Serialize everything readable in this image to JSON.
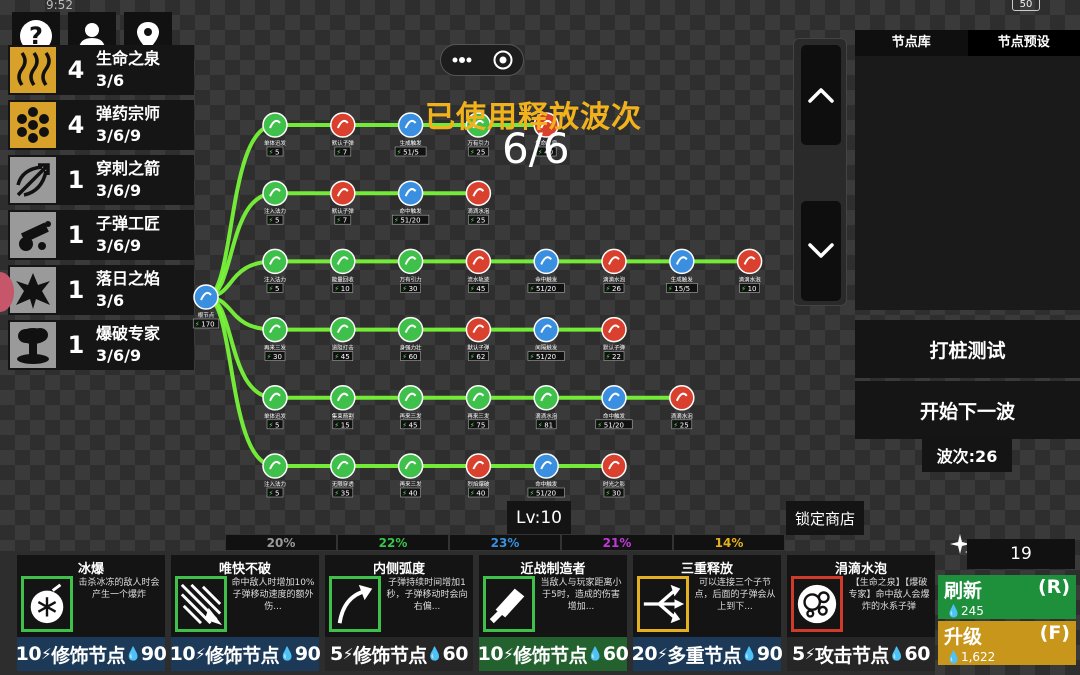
{
  "status": {
    "time": "9:52",
    "battery": "50"
  },
  "top_buttons": [
    {
      "icon": "help-icon"
    },
    {
      "icon": "user-icon"
    },
    {
      "icon": "location-icon"
    }
  ],
  "synergies": [
    {
      "icon": "steam-icon",
      "count": "4",
      "name": "生命之泉",
      "tiers": "3/6",
      "color": "gold"
    },
    {
      "icon": "ammo-icon",
      "count": "4",
      "name": "弹药宗师",
      "tiers": "3/6/9",
      "color": "gold"
    },
    {
      "icon": "arrow-icon",
      "count": "1",
      "name": "穿刺之箭",
      "tiers": "3/6/9",
      "color": "gray"
    },
    {
      "icon": "cannon-icon",
      "count": "1",
      "name": "子弹工匠",
      "tiers": "3/6/9",
      "color": "gray"
    },
    {
      "icon": "flame-icon",
      "count": "1",
      "name": "落日之焰",
      "tiers": "3/6",
      "color": "gray"
    },
    {
      "icon": "explosion-icon",
      "count": "1",
      "name": "爆破专家",
      "tiers": "3/6/9",
      "color": "gray"
    }
  ],
  "overlay": {
    "wave_used_title": "已使用释放波次",
    "wave_used_count": "6/6"
  },
  "graph": {
    "root": {
      "label": "根节点",
      "value": "170"
    },
    "rows": [
      {
        "nodes": [
          {
            "kind": "green",
            "label": "单体迅发",
            "value": "5"
          },
          {
            "kind": "red",
            "label": "默认子弹",
            "value": "7"
          },
          {
            "kind": "blue",
            "label": "生成触发",
            "value": "51/5"
          },
          {
            "kind": "green",
            "label": "万有引力",
            "value": "25"
          },
          {
            "kind": "red",
            "label": "生命之泉",
            "value": "40"
          }
        ]
      },
      {
        "nodes": [
          {
            "kind": "green",
            "label": "注入法力",
            "value": "5"
          },
          {
            "kind": "red",
            "label": "默认子弹",
            "value": "7"
          },
          {
            "kind": "blue",
            "label": "命中触发",
            "value": "51/20"
          },
          {
            "kind": "red",
            "label": "滴滴水泡",
            "value": "25"
          }
        ]
      },
      {
        "nodes": [
          {
            "kind": "green",
            "label": "注入法力",
            "value": "5"
          },
          {
            "kind": "green",
            "label": "能量回收",
            "value": "10"
          },
          {
            "kind": "green",
            "label": "万有引力",
            "value": "30"
          },
          {
            "kind": "red",
            "label": "流水轨迹",
            "value": "45"
          },
          {
            "kind": "blue",
            "label": "命中触发",
            "value": "51/20"
          },
          {
            "kind": "red",
            "label": "滴滴水泡",
            "value": "26"
          },
          {
            "kind": "blue",
            "label": "生成触发",
            "value": "15/5"
          },
          {
            "kind": "red",
            "label": "滴滴水泡",
            "value": "10"
          }
        ]
      },
      {
        "nodes": [
          {
            "kind": "green",
            "label": "再来三发",
            "value": "30"
          },
          {
            "kind": "green",
            "label": "道阻打击",
            "value": "45"
          },
          {
            "kind": "green",
            "label": "身强力壮",
            "value": "60"
          },
          {
            "kind": "red",
            "label": "默认子弹",
            "value": "62"
          },
          {
            "kind": "blue",
            "label": "间隔触发",
            "value": "51/20"
          },
          {
            "kind": "red",
            "label": "默认子弹",
            "value": "22"
          }
        ]
      },
      {
        "nodes": [
          {
            "kind": "green",
            "label": "单体迅发",
            "value": "5"
          },
          {
            "kind": "green",
            "label": "集束箭割",
            "value": "15"
          },
          {
            "kind": "green",
            "label": "再来三发",
            "value": "45"
          },
          {
            "kind": "green",
            "label": "再来三发",
            "value": "75"
          },
          {
            "kind": "green",
            "label": "滴滴水泡",
            "value": "81"
          },
          {
            "kind": "blue",
            "label": "命中触发",
            "value": "51/20"
          },
          {
            "kind": "red",
            "label": "滴滴水泡",
            "value": "25"
          }
        ]
      },
      {
        "nodes": [
          {
            "kind": "green",
            "label": "注入法力",
            "value": "5"
          },
          {
            "kind": "green",
            "label": "无限穿透",
            "value": "35"
          },
          {
            "kind": "green",
            "label": "再来三发",
            "value": "40"
          },
          {
            "kind": "red",
            "label": "烈焰爆破",
            "value": "40"
          },
          {
            "kind": "blue",
            "label": "命中触发",
            "value": "51/20"
          },
          {
            "kind": "red",
            "label": "时光之影",
            "value": "30"
          }
        ]
      }
    ]
  },
  "scroll": {
    "up_icon": "chevron-up-icon",
    "down_icon": "chevron-down-icon"
  },
  "library": {
    "tab_library": "节点库",
    "tab_presets": "节点预设"
  },
  "actions": {
    "test_dummy": "打桩测试",
    "next_wave": "开始下一波",
    "wave_label": "波次:26"
  },
  "level": "Lv:10",
  "lock_shop": "锁定商店",
  "odds": [
    {
      "value": "20%",
      "color": "#9a9a9a"
    },
    {
      "value": "22%",
      "color": "#3bc24a"
    },
    {
      "value": "23%",
      "color": "#3a8fe0"
    },
    {
      "value": "21%",
      "color": "#c13ad9"
    },
    {
      "value": "14%",
      "color": "#e2b020"
    }
  ],
  "shop": [
    {
      "title": "冰爆",
      "icon": "ice-bomb-icon",
      "border": "#3fc04b",
      "desc": "击杀冰冻的敌人时会产生一个爆炸",
      "cost": "10",
      "type": "修饰节点",
      "price": "90",
      "footer": "blue"
    },
    {
      "title": "唯快不破",
      "icon": "speed-lines-icon",
      "border": "#3fc04b",
      "desc": "命中敌人时增加10%子弹移动速度的额外伤...",
      "cost": "10",
      "type": "修饰节点",
      "price": "90",
      "footer": "blue"
    },
    {
      "title": "内侧弧度",
      "icon": "curve-arrow-icon",
      "border": "#3fc04b",
      "desc": "子弹持续时间增加1秒，子弹移动时会向右偏...",
      "cost": "5",
      "type": "修饰节点",
      "price": "60",
      "footer": "dark"
    },
    {
      "title": "近战制造者",
      "icon": "cleaver-icon",
      "border": "#3fc04b",
      "desc": "当敌人与玩家距离小于5时，造成的伤害增加...",
      "cost": "10",
      "type": "修饰节点",
      "price": "60",
      "footer": "green"
    },
    {
      "title": "三重释放",
      "icon": "triple-split-icon",
      "border": "#e2b020",
      "desc": "可以连接三个子节点，后面的子弹会从上到下...",
      "cost": "20",
      "type": "多重节点",
      "price": "90",
      "footer": "blue"
    },
    {
      "title": "涓滴水泡",
      "icon": "bubbles-icon",
      "border": "#d03a2a",
      "desc": "【生命之泉】【爆破专家】命中敌人会爆炸的水系子弹",
      "cost": "5",
      "type": "攻击节点",
      "price": "60",
      "footer": "dark"
    }
  ],
  "resources": {
    "gems": "19",
    "refresh_label": "刷新",
    "refresh_key": "(R)",
    "refresh_cost": "245",
    "upgrade_label": "升级",
    "upgrade_key": "(F)",
    "upgrade_cost": "1,622"
  },
  "colors": {
    "node_green": "#3fc04b",
    "node_red": "#d9402e",
    "node_blue": "#3a8fe0",
    "link_green": "#7cff3a",
    "gold": "#f2b21c"
  }
}
